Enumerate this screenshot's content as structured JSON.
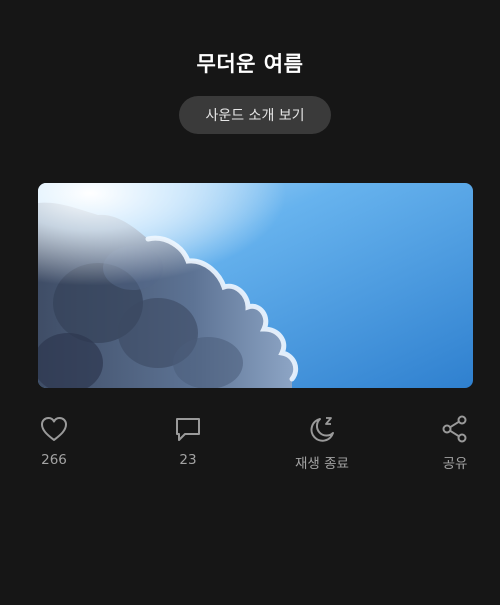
{
  "sound": {
    "title": "무더운 여름",
    "intro_button_label": "사운드 소개 보기"
  },
  "cover": {
    "icon": "sky-clouds-image",
    "colors": {
      "sky": "#4a9ee6",
      "sky_dark": "#2f78c4",
      "cloud": "#5a6e8c"
    }
  },
  "actions": {
    "like": {
      "icon": "heart-icon",
      "count": "266"
    },
    "comment": {
      "icon": "comment-icon",
      "count": "23"
    },
    "sleep_timer": {
      "icon": "moon-sleep-icon",
      "label": "재생 종료"
    },
    "share": {
      "icon": "share-icon",
      "label": "공유"
    }
  },
  "theme": {
    "background": "#161616",
    "button_bg": "#3a3a3a",
    "icon_color": "#9a9a9a"
  }
}
